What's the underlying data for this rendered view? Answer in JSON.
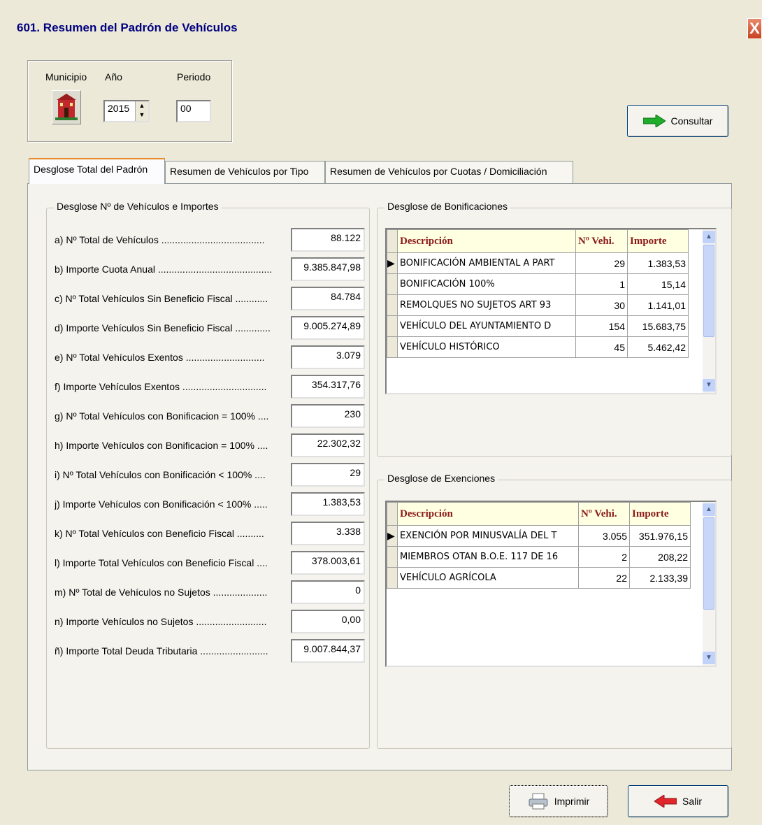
{
  "window": {
    "title": "601. Resumen del Padrón de Vehículos",
    "close_glyph": "X"
  },
  "params": {
    "municipio_label": "Municipio",
    "anio_label": "Año",
    "anio_value": "2015",
    "periodo_label": "Periodo",
    "periodo_value": "00"
  },
  "buttons": {
    "consultar": "Consultar",
    "imprimir": "Imprimir",
    "salir": "Salir"
  },
  "tabs": [
    {
      "label": "Desglose Total del Padrón"
    },
    {
      "label": "Resumen de Vehículos por Tipo"
    },
    {
      "label": "Resumen de Vehículos por Cuotas / Domiciliación"
    }
  ],
  "desglose": {
    "title": "Desglose Nº de Vehículos e Importes",
    "rows": [
      {
        "label": "a) Nº Total de Vehículos ......................................",
        "value": "88.122"
      },
      {
        "label": "b) Importe Cuota Anual ..........................................",
        "value": "9.385.847,98"
      },
      {
        "label": "c) Nº Total Vehículos Sin Beneficio Fiscal ............",
        "value": "84.784"
      },
      {
        "label": "d) Importe Vehículos Sin Beneficio Fiscal .............",
        "value": "9.005.274,89"
      },
      {
        "label": "e) Nº Total Vehículos Exentos .............................",
        "value": "3.079"
      },
      {
        "label": "f) Importe Vehículos Exentos ...............................",
        "value": "354.317,76"
      },
      {
        "label": "g) Nº Total Vehículos con Bonificacion = 100% ....",
        "value": "230"
      },
      {
        "label": "h) Importe  Vehículos con Bonificacion = 100% ....",
        "value": "22.302,32"
      },
      {
        "label": "i) Nº Total Vehículos con Bonificación < 100% ....",
        "value": "29"
      },
      {
        "label": "j) Importe Vehículos con Bonificación < 100% .....",
        "value": "1.383,53"
      },
      {
        "label": "k) Nº Total Vehículos con Beneficio Fiscal ..........",
        "value": "3.338"
      },
      {
        "label": "l) Importe Total Vehículos con Beneficio Fiscal ....",
        "value": "378.003,61"
      },
      {
        "label": "m) Nº Total de Vehículos no Sujetos ....................",
        "value": "0"
      },
      {
        "label": "n) Importe Vehículos no Sujetos ..........................",
        "value": "0,00"
      },
      {
        "label": "ñ) Importe Total Deuda Tributaria .........................",
        "value": "9.007.844,37"
      }
    ]
  },
  "bonificaciones": {
    "title": "Desglose de Bonificaciones",
    "columns": [
      "Descripción",
      "Nº Vehi.",
      "Importe"
    ],
    "rows": [
      [
        "BONIFICACIÓN AMBIENTAL A PART",
        "29",
        "1.383,53"
      ],
      [
        "BONIFICACIÓN 100%",
        "1",
        "15,14"
      ],
      [
        "REMOLQUES NO SUJETOS ART 93",
        "30",
        "1.141,01"
      ],
      [
        "VEHÍCULO DEL AYUNTAMIENTO D",
        "154",
        "15.683,75"
      ],
      [
        "VEHÍCULO HISTÓRICO",
        "45",
        "5.462,42"
      ]
    ]
  },
  "exenciones": {
    "title": "Desglose de Exenciones",
    "columns": [
      "Descripción",
      "Nº Vehi.",
      "Importe"
    ],
    "rows": [
      [
        "EXENCIÓN POR MINUSVALÍA DEL T",
        "3.055",
        "351.976,15"
      ],
      [
        "MIEMBROS OTAN B.O.E. 117 DE 16",
        "2",
        "208,22"
      ],
      [
        "VEHÍCULO AGRÍCOLA",
        "22",
        "2.133,39"
      ]
    ]
  },
  "icons": {
    "town_hall": "town-hall-icon",
    "consultar": "green-arrow-right-icon",
    "imprimir": "printer-icon",
    "salir": "red-arrow-left-icon"
  },
  "colors": {
    "title_text": "#000080",
    "grid_header_bg": "#ffffe1",
    "grid_header_text": "#8b1a1a",
    "active_tab_accent": "#e68b2c"
  }
}
